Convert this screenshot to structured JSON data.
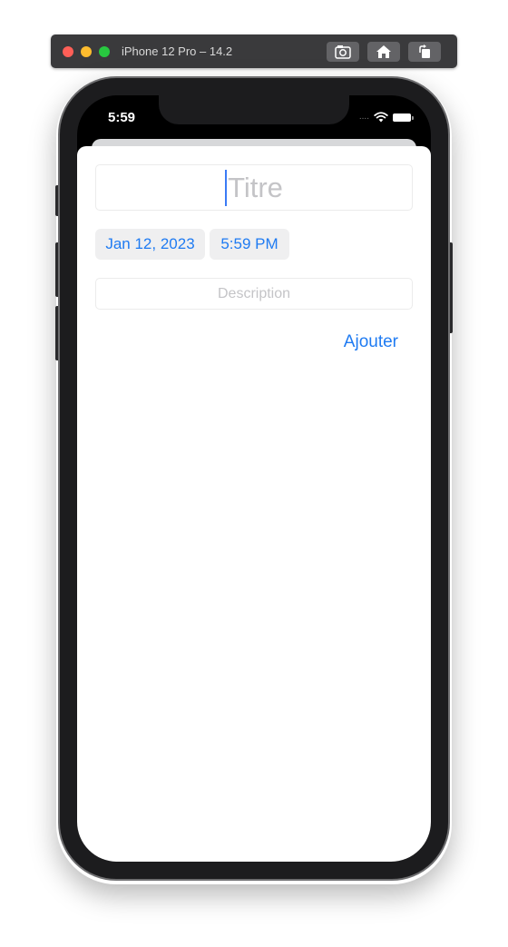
{
  "simulator": {
    "title": "iPhone 12 Pro – 14.2",
    "buttons": {
      "screenshot": "camera-icon",
      "home": "home-icon",
      "rotate": "rotate-icon"
    }
  },
  "status_bar": {
    "time": "5:59",
    "signal": "....",
    "wifi_icon": "wifi-icon",
    "battery_icon": "battery-icon"
  },
  "form": {
    "title_placeholder": "Titre",
    "date": "Jan 12, 2023",
    "time": "5:59 PM",
    "description_placeholder": "Description",
    "add_label": "Ajouter"
  },
  "colors": {
    "accent": "#1f7bf2",
    "placeholder": "#c4c4c7",
    "chip_background": "#efeff0"
  }
}
